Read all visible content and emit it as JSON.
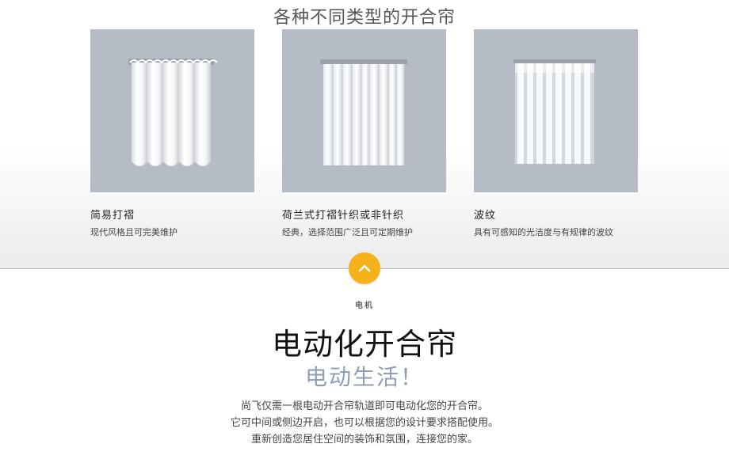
{
  "section": {
    "title": "各种不同类型的开合帘"
  },
  "cards": [
    {
      "title": "简易打褶",
      "desc": "现代风格且可完美维护",
      "icon": "pleated-curtain-illustration"
    },
    {
      "title": "荷兰式打褶针织或非针织",
      "desc": "经典，选择范围广泛且可定期维护",
      "icon": "dutch-pleat-curtain-illustration"
    },
    {
      "title": "波纹",
      "desc": "具有可感知的光洁度与有规律的波纹",
      "icon": "wave-curtain-illustration"
    }
  ],
  "toggle": {
    "icon": "chevron-up-icon",
    "color": "#f5b21b"
  },
  "motor": {
    "eyebrow": "电机",
    "title": "电动化开合帘",
    "subtitle": "电动生活！",
    "lines": [
      "尚飞仅需一根电动开合帘轨道即可电动化您的开合帘。",
      "它可中间或侧边开启，也可以根据您的设计要求搭配使用。",
      "重新创造您居住空间的装饰和氛围，连接您的家。"
    ]
  },
  "colors": {
    "card_bg": "#b5bcc6",
    "subtitle": "#8ea0b6",
    "accent": "#f5b21b"
  }
}
